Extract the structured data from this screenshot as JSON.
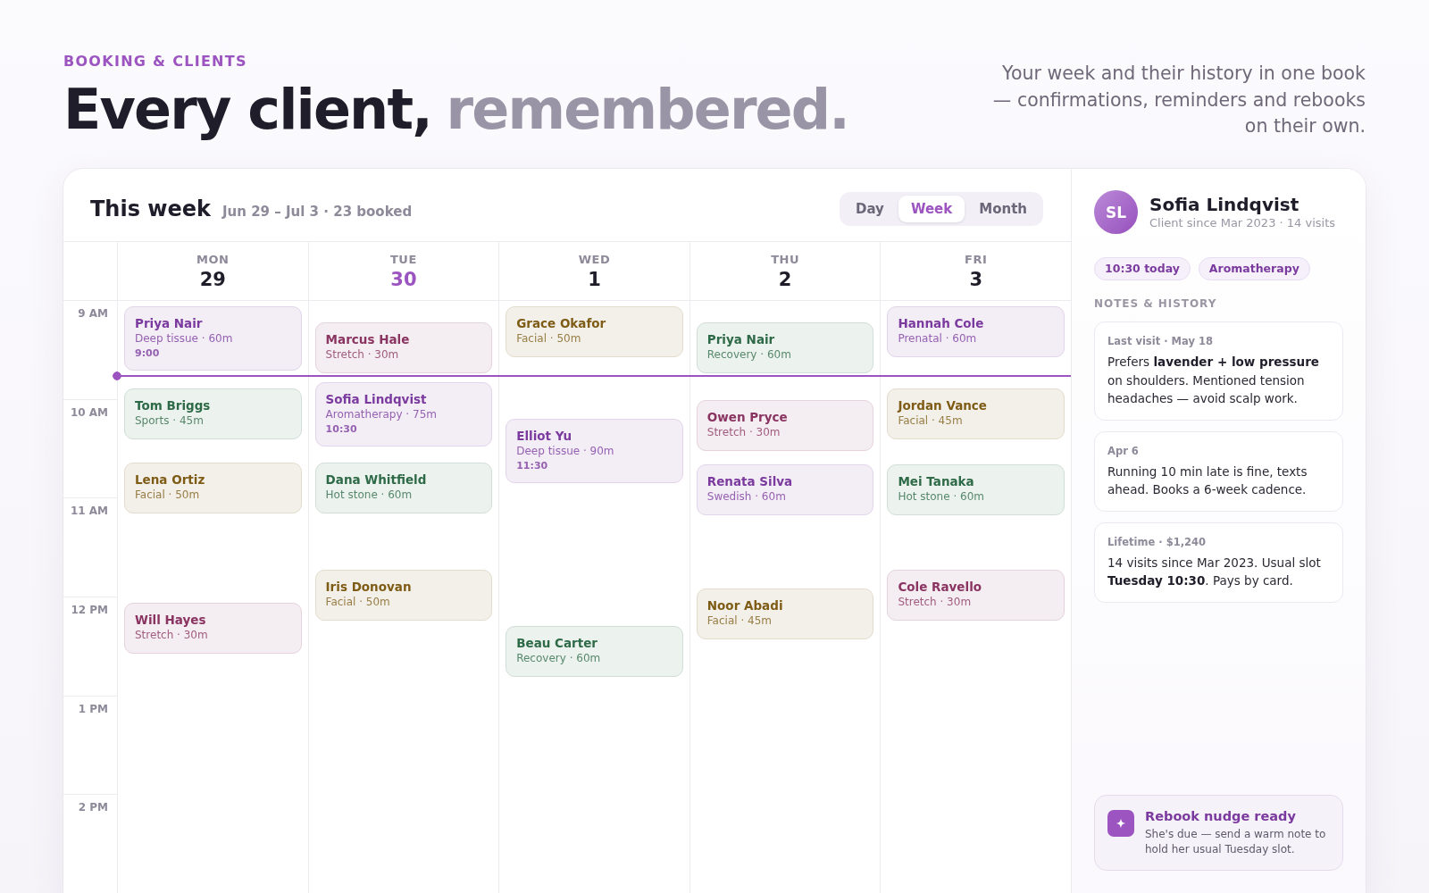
{
  "header": {
    "eyebrow": "BOOKING & CLIENTS",
    "headline": {
      "lead": "Every client,",
      "accent": "remembered."
    },
    "tagline": "Your week and their history in one book — confirmations, reminders and rebooks on their own."
  },
  "calendar": {
    "title": "This week",
    "subtitle": "Jun 29 – Jul 3 · 23 booked",
    "views": [
      {
        "label": "Day",
        "selected": false
      },
      {
        "label": "Week",
        "selected": true
      },
      {
        "label": "Month",
        "selected": false
      }
    ],
    "hours": [
      "9 AM",
      "10 AM",
      "11 AM",
      "12 PM",
      "1 PM",
      "2 PM"
    ],
    "days": [
      {
        "label": "MON",
        "number": "29",
        "today": false,
        "events": [
          {
            "client": "Priya Nair",
            "detail": "Deep tissue · 60m",
            "time": "9:00",
            "color": "#7b3a9e"
          },
          {
            "client": "Tom Briggs",
            "detail": "Sports · 45m",
            "color": "#2e6a47"
          },
          {
            "client": "Lena Ortiz",
            "detail": "Facial · 50m",
            "color": "#7e5c16"
          },
          {
            "client": "Will Hayes",
            "detail": "Stretch · 30m",
            "color": "#8a3461"
          }
        ]
      },
      {
        "label": "TUE",
        "number": "30",
        "today": true,
        "events": [
          {
            "client": "Marcus Hale",
            "detail": "Stretch · 30m",
            "color": "#8a3461"
          },
          {
            "client": "Sofia Lindqvist",
            "detail": "Aromatherapy · 75m",
            "time": "10:30",
            "color": "#7b3a9e"
          },
          {
            "client": "Dana Whitfield",
            "detail": "Hot stone · 60m",
            "color": "#2e6a47"
          },
          {
            "client": "Iris Donovan",
            "detail": "Facial · 50m",
            "color": "#7e5c16"
          }
        ]
      },
      {
        "label": "WED",
        "number": "1",
        "today": false,
        "events": [
          {
            "client": "Grace Okafor",
            "detail": "Facial · 50m",
            "color": "#7e5c16"
          },
          {
            "client": "Elliot Yu",
            "detail": "Deep tissue · 90m",
            "time": "11:30",
            "color": "#7b3a9e"
          },
          {
            "client": "Beau Carter",
            "detail": "Recovery · 60m",
            "color": "#2e6a47"
          }
        ]
      },
      {
        "label": "THU",
        "number": "2",
        "today": false,
        "events": [
          {
            "client": "Priya Nair",
            "detail": "Recovery · 60m",
            "color": "#2e6a47"
          },
          {
            "client": "Owen Pryce",
            "detail": "Stretch · 30m",
            "color": "#8a3461"
          },
          {
            "client": "Renata Silva",
            "detail": "Swedish · 60m",
            "color": "#7b3a9e"
          },
          {
            "client": "Noor Abadi",
            "detail": "Facial · 45m",
            "color": "#7e5c16"
          }
        ]
      },
      {
        "label": "FRI",
        "number": "3",
        "today": false,
        "events": [
          {
            "client": "Hannah Cole",
            "detail": "Prenatal · 60m",
            "color": "#7b3a9e"
          },
          {
            "client": "Jordan Vance",
            "detail": "Facial · 45m",
            "color": "#7e5c16"
          },
          {
            "client": "Mei Tanaka",
            "detail": "Hot stone · 60m",
            "color": "#2e6a47"
          },
          {
            "client": "Cole Ravello",
            "detail": "Stretch · 30m",
            "color": "#8a3461"
          }
        ]
      }
    ]
  },
  "client_panel": {
    "initials": "SL",
    "name": "Sofia Lindqvist",
    "meta": "Client since Mar 2023 · 14 visits",
    "chips": [
      "10:30 today",
      "Aromatherapy"
    ],
    "notes_heading": "NOTES & HISTORY",
    "notes": [
      {
        "label": "Last visit · May 18",
        "text": "Prefers **lavender + low pressure** on shoulders. Mentioned tension headaches — avoid scalp work."
      },
      {
        "label": "Apr 6",
        "text": "Running 10 min late is fine, texts ahead. Books a 6-week cadence."
      },
      {
        "label": "Lifetime · $1,240",
        "text": "14 visits since Mar 2023. Usual slot **Tuesday 10:30**. Pays by card."
      }
    ],
    "nudge": {
      "title": "Rebook nudge ready",
      "text": "She's due — send a warm note to hold her usual Tuesday slot."
    }
  }
}
